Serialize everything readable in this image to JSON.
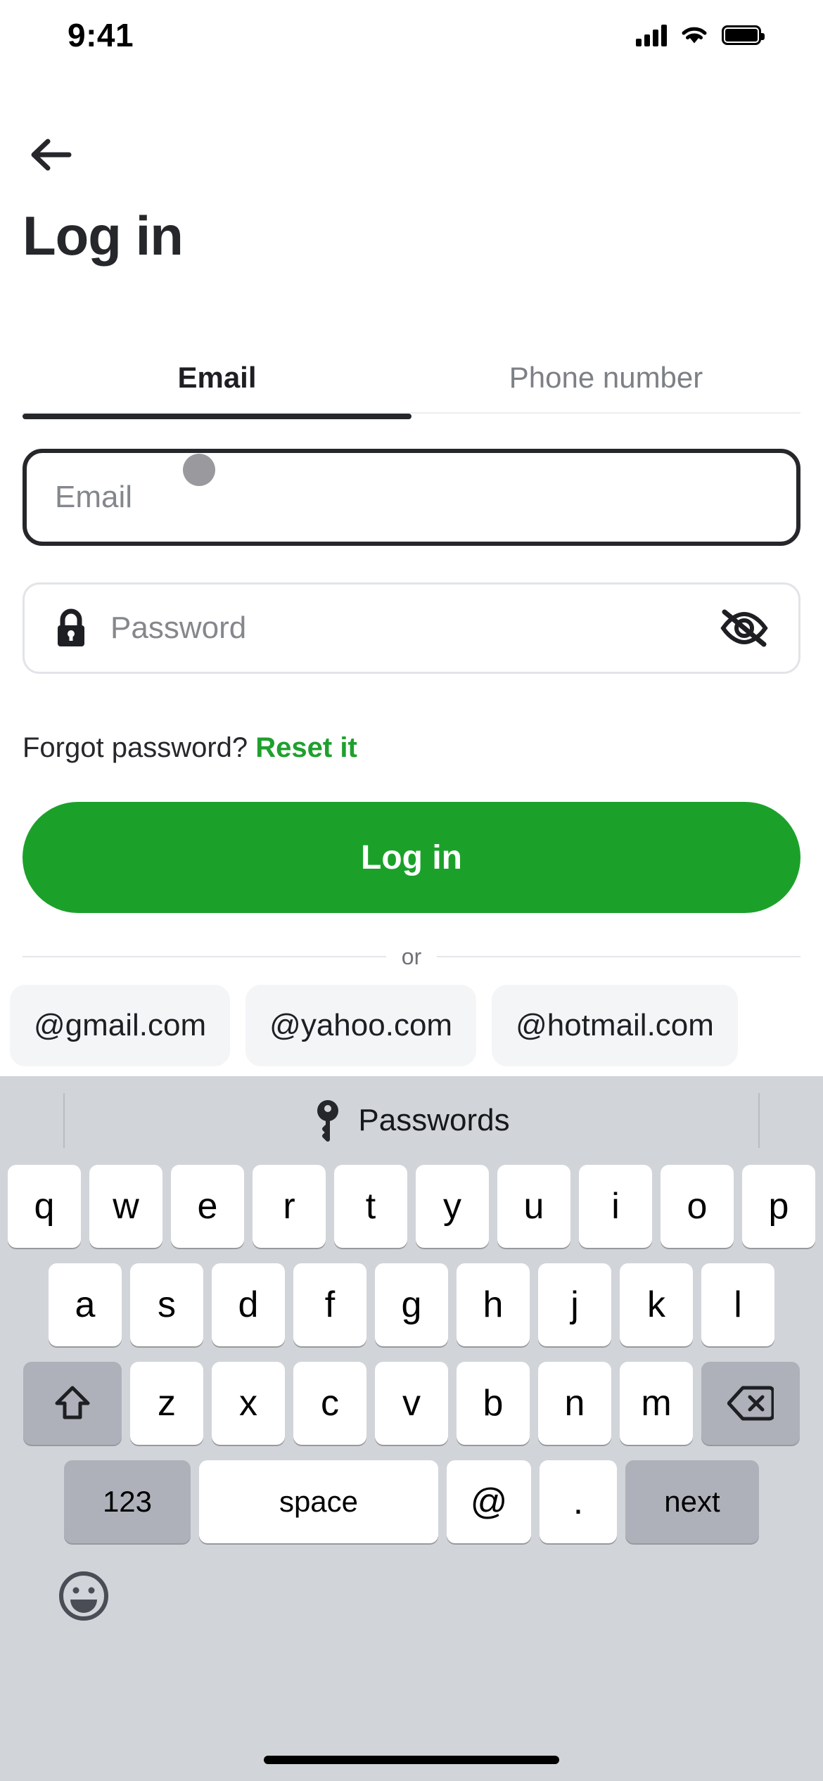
{
  "status_bar": {
    "time": "9:41",
    "signal_icon": "cellular-signal-icon",
    "wifi_icon": "wifi-icon",
    "battery_icon": "battery-icon"
  },
  "header": {
    "back_icon": "back-arrow-icon",
    "title": "Log in"
  },
  "tabs": [
    {
      "label": "Email",
      "active": true
    },
    {
      "label": "Phone number",
      "active": false
    }
  ],
  "form": {
    "email": {
      "placeholder": "Email",
      "value": "",
      "focused": true
    },
    "password": {
      "placeholder": "Password",
      "value": "",
      "lock_icon": "lock-icon",
      "visibility_icon": "eye-off-icon"
    },
    "forgot_text": "Forgot password?",
    "forgot_link": "Reset it",
    "submit_label": "Log in"
  },
  "divider": {
    "text": "or"
  },
  "suggestion_chips": [
    "@gmail.com",
    "@yahoo.com",
    "@hotmail.com"
  ],
  "keyboard": {
    "suggestion_bar": {
      "key_icon": "key-icon",
      "label": "Passwords"
    },
    "row1": [
      "q",
      "w",
      "e",
      "r",
      "t",
      "y",
      "u",
      "i",
      "o",
      "p"
    ],
    "row2": [
      "a",
      "s",
      "d",
      "f",
      "g",
      "h",
      "j",
      "k",
      "l"
    ],
    "row3": [
      "z",
      "x",
      "c",
      "v",
      "b",
      "n",
      "m"
    ],
    "shift_icon": "shift-icon",
    "backspace_icon": "backspace-icon",
    "numbers_label": "123",
    "space_label": "space",
    "at_label": "@",
    "dot_label": ".",
    "next_label": "next",
    "emoji_icon": "emoji-icon"
  },
  "colors": {
    "accent_green": "#1ba12a",
    "link_green": "#1fa02e",
    "text_dark": "#25272b",
    "text_muted": "#7d8085",
    "keyboard_bg": "#d1d4d9",
    "key_dark": "#aeb1b9",
    "chip_bg": "#f4f5f7"
  }
}
